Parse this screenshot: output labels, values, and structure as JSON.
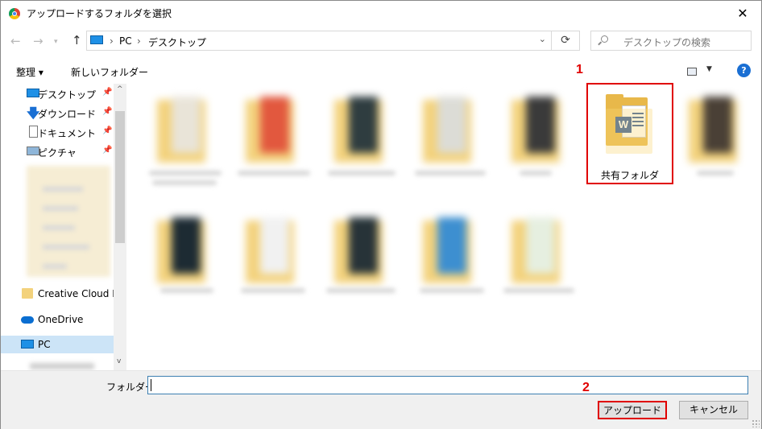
{
  "window": {
    "title": "アップロードするフォルダを選択"
  },
  "address": {
    "crumbs": [
      "PC",
      "デスクトップ"
    ],
    "search_placeholder": "デスクトップの検索"
  },
  "toolbar": {
    "organize_label": "整理 ▾",
    "new_folder_label": "新しいフォルダー"
  },
  "sidebar": {
    "items": [
      {
        "label": "デスクトップ",
        "icon": "desktop-icon",
        "pinned": true
      },
      {
        "label": "ダウンロード",
        "icon": "download-icon",
        "pinned": true
      },
      {
        "label": "ドキュメント",
        "icon": "document-icon",
        "pinned": true
      },
      {
        "label": "ピクチャ",
        "icon": "picture-icon",
        "pinned": true
      },
      {
        "label": "Creative Cloud File",
        "icon": "creative-cloud-icon"
      },
      {
        "label": "OneDrive",
        "icon": "onedrive-icon"
      },
      {
        "label": "PC",
        "icon": "pc-icon",
        "selected": true
      }
    ]
  },
  "content": {
    "highlighted_folder_label": "共有フォルダ",
    "step1": "1",
    "step2": "2"
  },
  "footer": {
    "folder_label": "フォルダー:",
    "folder_value": "",
    "upload_label": "アップロード",
    "cancel_label": "キャンセル"
  },
  "colors": {
    "highlight": "#e00000",
    "selection": "#cce4f7",
    "accent": "#1a6fd3"
  }
}
